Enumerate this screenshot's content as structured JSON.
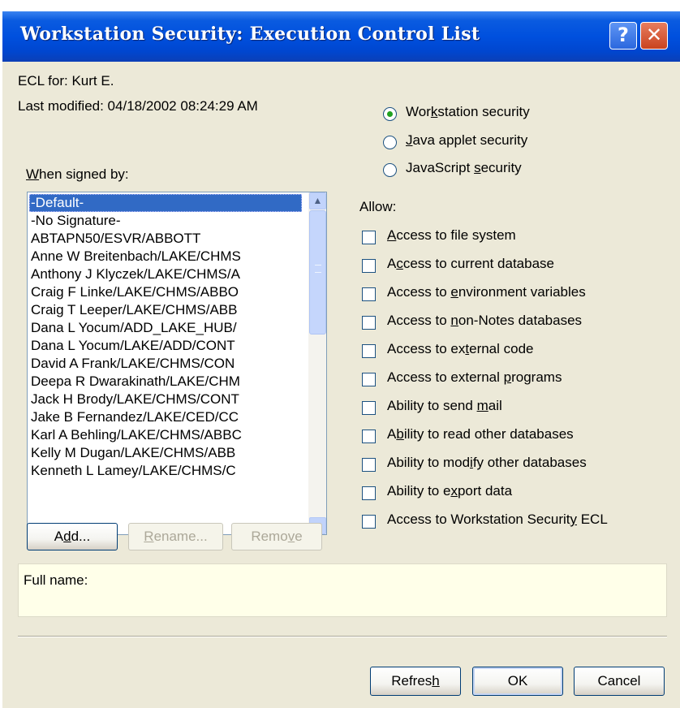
{
  "window": {
    "title": "Workstation Security:  Execution Control List"
  },
  "titlebar": {
    "help_glyph": "?",
    "close_glyph": "✕"
  },
  "info": {
    "ecl_for": "ECL for:  Kurt E.",
    "last_modified": "Last modified:  04/18/2002 08:24:29 AM"
  },
  "security_type": {
    "options": [
      {
        "pre": "Wor",
        "key": "k",
        "post": "station security",
        "checked": true
      },
      {
        "pre": "",
        "key": "J",
        "post": "ava applet security",
        "checked": false
      },
      {
        "pre": "JavaScript ",
        "key": "s",
        "post": "ecurity",
        "checked": false
      }
    ]
  },
  "signers": {
    "label_key": "W",
    "label_rest": "hen signed by:",
    "items": [
      "-Default-",
      "-No Signature-",
      "ABTAPN50/ESVR/ABBOTT",
      "Anne W Breitenbach/LAKE/CHMS",
      "Anthony J Klyczek/LAKE/CHMS/A",
      "Craig F Linke/LAKE/CHMS/ABBO",
      "Craig T Leeper/LAKE/CHMS/ABB",
      "Dana L Yocum/ADD_LAKE_HUB/",
      "Dana L Yocum/LAKE/ADD/CONT",
      "David A Frank/LAKE/CHMS/CON",
      "Deepa R Dwarakinath/LAKE/CHM",
      "Jack H Brody/LAKE/CHMS/CONT",
      "Jake B Fernandez/LAKE/CED/CC",
      "Karl A Behling/LAKE/CHMS/ABBC",
      "Kelly M Dugan/LAKE/CHMS/ABB",
      "Kenneth L Lamey/LAKE/CHMS/C"
    ],
    "selected_index": 0,
    "scroll_up_glyph": "▲",
    "scroll_down_glyph": "▼"
  },
  "allow": {
    "label": "Allow:",
    "options": [
      {
        "pre": "",
        "key": "A",
        "post": "ccess to file system",
        "checked": false
      },
      {
        "pre": "A",
        "key": "c",
        "post": "cess to current database",
        "checked": false
      },
      {
        "pre": "Access to ",
        "key": "e",
        "post": "nvironment variables",
        "checked": false
      },
      {
        "pre": "Access to ",
        "key": "n",
        "post": "on-Notes databases",
        "checked": false
      },
      {
        "pre": "Access to ex",
        "key": "t",
        "post": "ernal code",
        "checked": false
      },
      {
        "pre": "Access to external ",
        "key": "p",
        "post": "rograms",
        "checked": false
      },
      {
        "pre": "Ability to send ",
        "key": "m",
        "post": "ail",
        "checked": false
      },
      {
        "pre": "A",
        "key": "b",
        "post": "ility to read other databases",
        "checked": false
      },
      {
        "pre": "Ability to mod",
        "key": "i",
        "post": "fy other databases",
        "checked": false
      },
      {
        "pre": "Ability to e",
        "key": "x",
        "post": "port data",
        "checked": false
      },
      {
        "pre": "Access to Workstation Securit",
        "key": "y",
        "post": " ECL",
        "checked": false
      }
    ]
  },
  "list_buttons": {
    "add": {
      "pre": "A",
      "key": "d",
      "post": "d..."
    },
    "rename": {
      "pre": "",
      "key": "R",
      "post": "ename..."
    },
    "remove": {
      "pre": "Remo",
      "key": "v",
      "post": "e"
    }
  },
  "full_name": {
    "label": "Full name:"
  },
  "footer": {
    "refresh": {
      "pre": "Refres",
      "key": "h",
      "post": ""
    },
    "ok": "OK",
    "cancel": "Cancel"
  }
}
